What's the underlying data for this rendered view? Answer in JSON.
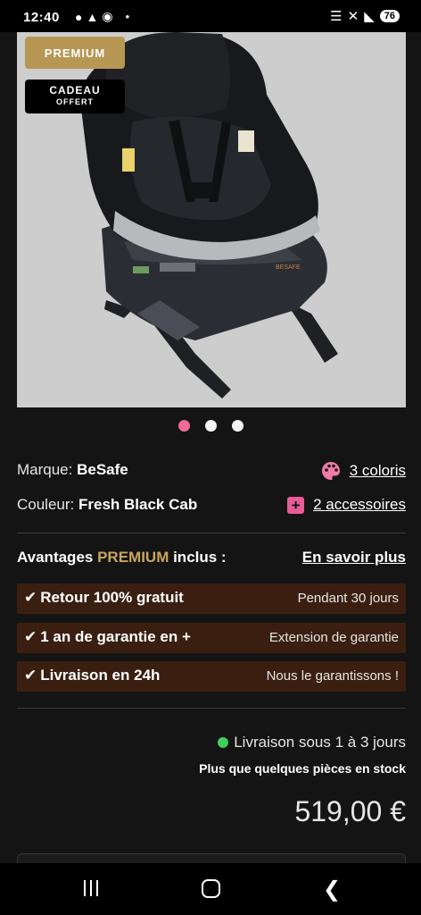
{
  "status_bar": {
    "time": "12:40",
    "left_icons": [
      "chat-icon",
      "notification-icon",
      "facebook-icon"
    ],
    "battery": "76"
  },
  "image": {
    "badge_premium": "PREMIUM",
    "badge_gift_line1": "CADEAU",
    "badge_gift_line2": "OFFERT",
    "seat_brand_mark": "BESAFE"
  },
  "carousel": {
    "count": 3,
    "active": 0,
    "active_color": "#f06c9b"
  },
  "product": {
    "brand_label": "Marque:",
    "brand_value": "BeSafe",
    "color_label": "Couleur:",
    "color_value": "Fresh Black Cab",
    "colors_link": "3 coloris",
    "accessories_link": "2 accessoires"
  },
  "advantages": {
    "title_pre": "Avantages ",
    "title_highlight": "PREMIUM",
    "title_post": " inclus :",
    "more_link": "En savoir plus",
    "items": [
      {
        "label": "Retour 100% gratuit",
        "detail": "Pendant 30 jours"
      },
      {
        "label": "1 an de garantie en +",
        "detail": "Extension de garantie"
      },
      {
        "label": "Livraison en 24h",
        "detail": "Nous le garantissons !"
      }
    ]
  },
  "purchase": {
    "delivery": "Livraison sous 1 à 3 jours",
    "stock": "Plus que quelques pièces en stock",
    "price": "519,00 €"
  },
  "colors": {
    "accent_gold": "#b69754",
    "advantage_bg": "#3a1f10",
    "in_stock": "#3fcf5a",
    "accent_pink": "#e85b98"
  }
}
